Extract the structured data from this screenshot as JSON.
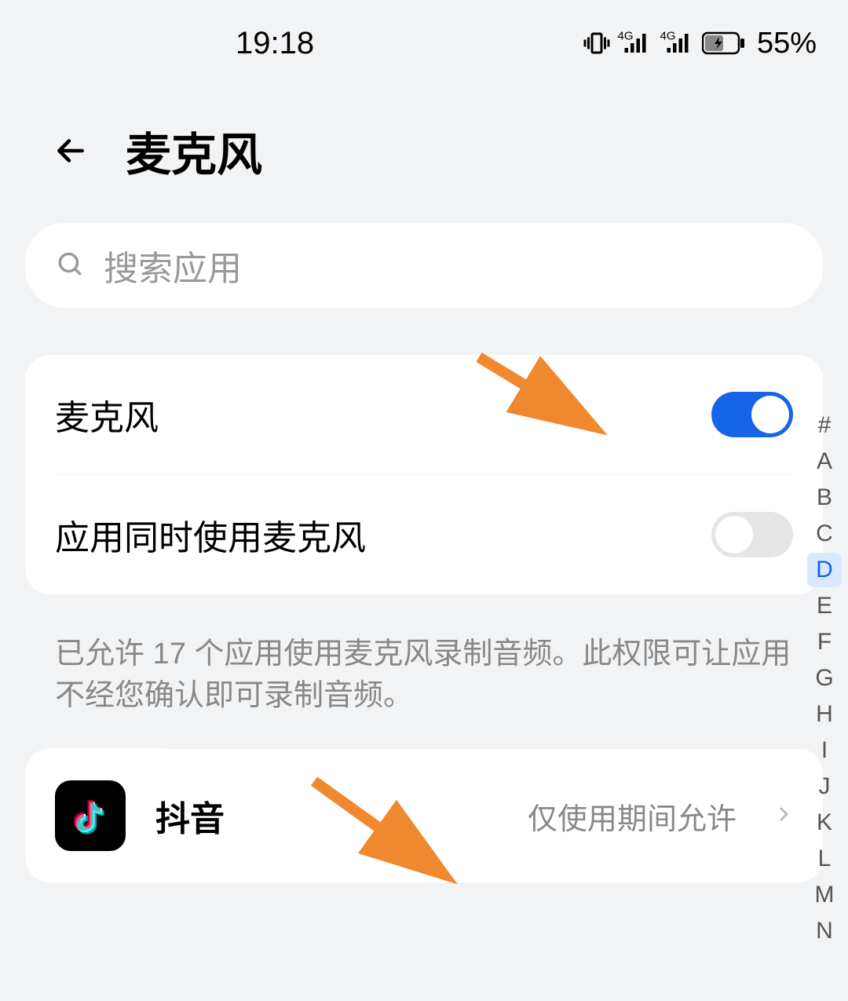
{
  "status": {
    "time": "19:18",
    "network_label_1": "4G",
    "network_label_2": "4G",
    "battery_pct": "55%"
  },
  "header": {
    "title": "麦克风"
  },
  "search": {
    "placeholder": "搜索应用"
  },
  "settings": {
    "mic_label": "麦克风",
    "mic_on": true,
    "multi_app_label": "应用同时使用麦克风",
    "multi_app_on": false
  },
  "description": "已允许 17 个应用使用麦克风录制音频。此权限可让应用不经您确认即可录制音频。",
  "apps": [
    {
      "name": "抖音",
      "status": "仅使用期间允许",
      "icon": "douyin"
    }
  ],
  "index": {
    "letters": [
      "#",
      "A",
      "B",
      "C",
      "D",
      "E",
      "F",
      "G",
      "H",
      "I",
      "J",
      "K",
      "L",
      "M",
      "N"
    ],
    "active": "D"
  }
}
